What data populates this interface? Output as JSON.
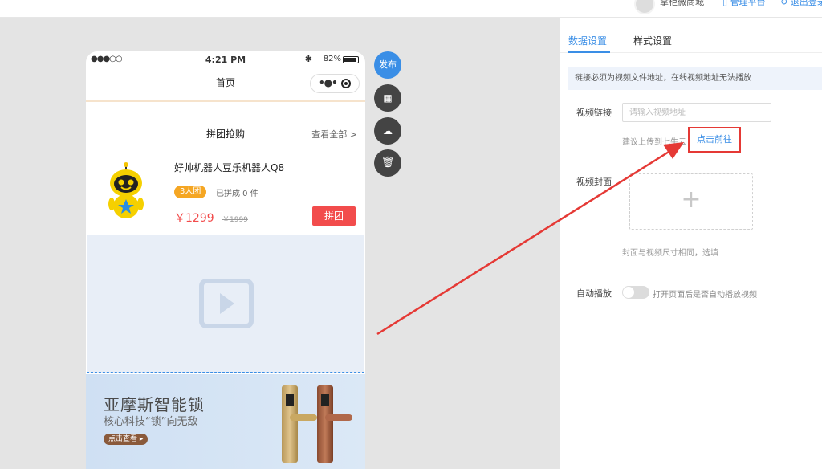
{
  "topbar": {
    "username": "掌柜微商城",
    "admin_link": "管理平台",
    "logout_link": "退出登录"
  },
  "phone": {
    "status": {
      "signal": "●●●○○",
      "time": "4:21 PM",
      "bluetooth": "✱",
      "battery": "82%"
    },
    "nav": {
      "title": "首页",
      "dots": "•●•"
    },
    "group": {
      "title": "拼团抢购",
      "more": "查看全部 >"
    },
    "product": {
      "name": "好帅机器人豆乐机器人Q8",
      "tag": "3人团",
      "sold": "已拼成 0 件",
      "price": "￥1299",
      "old_price": "￥1999",
      "buy": "拼团"
    },
    "banner": {
      "title": "亚摩斯智能锁",
      "subtitle": "核心科技“锁”向无敌",
      "cta": "点击查看 ▸"
    }
  },
  "tools": {
    "publish": "发布",
    "grid": "▦",
    "cloud": "☁",
    "trash": "🗑"
  },
  "panel": {
    "tabs": [
      "数据设置",
      "样式设置"
    ],
    "active_tab": 0,
    "notice": "链接必须为视频文件地址，在线视频地址无法播放",
    "video_link_label": "视频链接",
    "video_link_placeholder": "请输入视频地址",
    "video_link_value": "",
    "upload_hint": "建议上传到七牛云",
    "go_link": "点击前往",
    "cover_label": "视频封面",
    "cover_plus": "+",
    "cover_hint": "封面与视频尺寸相同，选填",
    "autoplay_label": "自动播放",
    "autoplay_on": false,
    "autoplay_hint": "打开页面后是否自动播放视频"
  },
  "colors": {
    "accent": "#3a8ee6",
    "price": "#f24c4c",
    "tag": "#f5a623",
    "annotation": "#e53935"
  }
}
